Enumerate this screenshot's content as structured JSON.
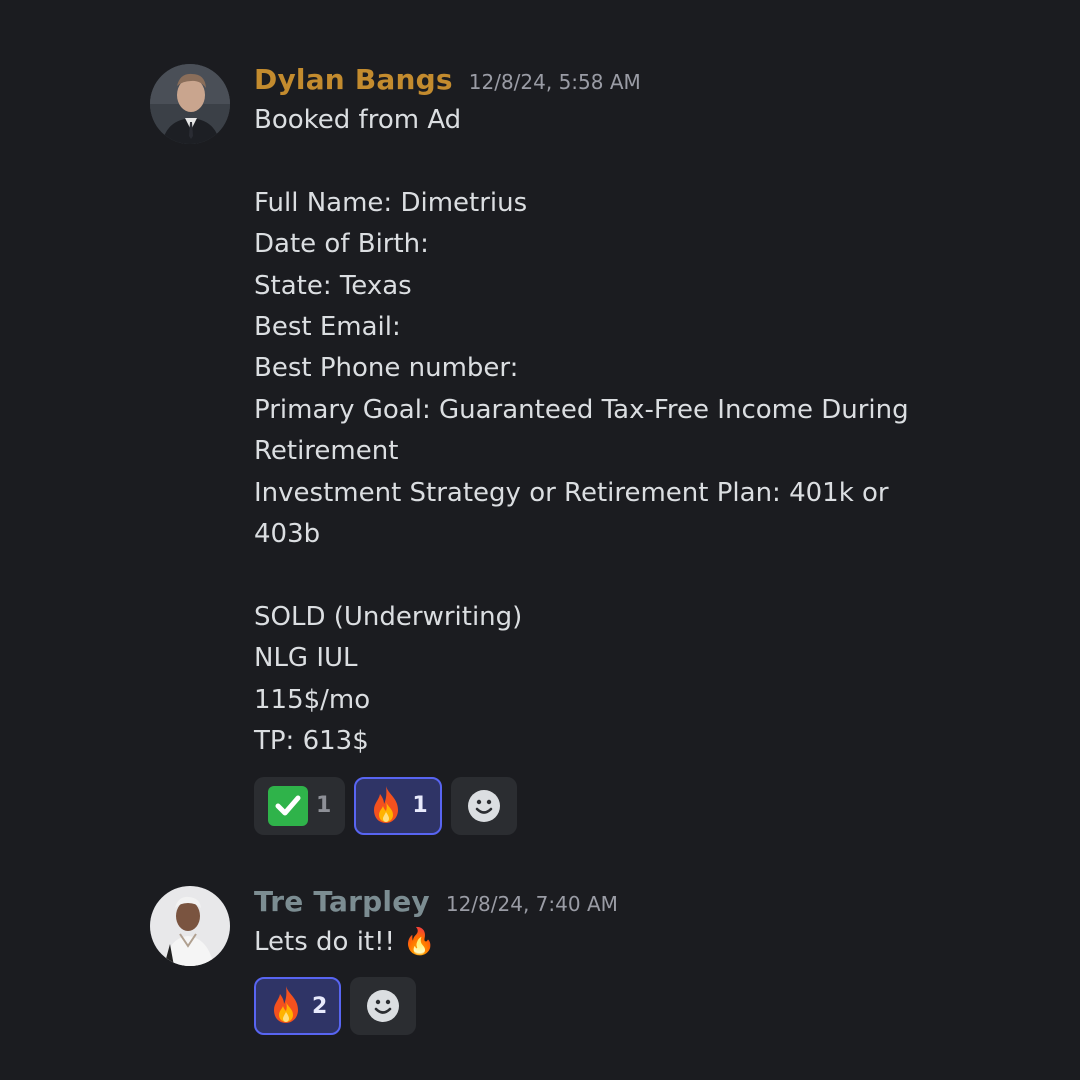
{
  "messages": [
    {
      "author": "Dylan Bangs",
      "author_color": "#c38b2e",
      "timestamp": "12/8/24, 5:58 AM",
      "text": "Booked from Ad\n\nFull Name: Dimetrius\nDate of Birth:\nState: Texas\nBest Email:\nBest Phone number:\nPrimary Goal: Guaranteed Tax-Free Income During Retirement\nInvestment Strategy or Retirement Plan: 401k or 403b\n\nSOLD (Underwriting)\nNLG IUL\n115$/mo\nTP: 613$",
      "reactions": [
        {
          "emoji": "check-mark-icon",
          "count": "1",
          "active": false
        },
        {
          "emoji": "fire-icon",
          "count": "1",
          "active": true
        }
      ]
    },
    {
      "author": "Tre Tarpley",
      "author_color": "#7c8d92",
      "timestamp": "12/8/24, 7:40 AM",
      "text": "Lets do it!! 🔥",
      "reactions": [
        {
          "emoji": "fire-icon",
          "count": "2",
          "active": true
        }
      ]
    }
  ],
  "colors": {
    "background": "#1b1c20",
    "reaction_bg": "#2b2d31",
    "reaction_active_bg": "#2f3466",
    "reaction_active_border": "#5865f2",
    "timestamp": "#9a9ca5",
    "text": "#dbdee1"
  }
}
